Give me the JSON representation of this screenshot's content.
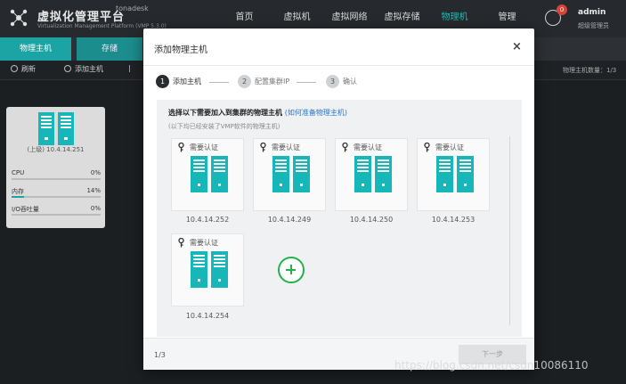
{
  "app": {
    "title": "虚拟化管理平台",
    "subtitle": "Virtualization Management Platform (VMP 5.3.0)",
    "user_line": "tonadesk"
  },
  "nav": [
    {
      "label": "首页"
    },
    {
      "label": "虚拟机"
    },
    {
      "label": "虚拟网络"
    },
    {
      "label": "虚拟存储"
    },
    {
      "label": "物理机"
    },
    {
      "label": "管理"
    }
  ],
  "notifications": {
    "count": "0"
  },
  "user": {
    "name": "admin",
    "role": "超级管理员"
  },
  "subtabs": [
    {
      "label": "物理主机"
    },
    {
      "label": "存储"
    }
  ],
  "toolbar": {
    "refresh_label": "刷新",
    "add_host_label": "添加主机",
    "more_label": "|",
    "host_count_label": "物理主机数量：1/3"
  },
  "host_card": {
    "name": "(上级) 10.4.14.251",
    "metrics": [
      {
        "label": "CPU",
        "value": "0%",
        "fill": 0.0
      },
      {
        "label": "内存",
        "value": "14%",
        "fill": 0.14
      },
      {
        "label": "I/O吞吐量",
        "value": "0%",
        "fill": 0.0
      }
    ]
  },
  "modal": {
    "title": "添加物理主机",
    "close_label": "×",
    "steps": [
      {
        "num": "1",
        "label": "添加主机"
      },
      {
        "num": "2",
        "label": "配置集群IP"
      },
      {
        "num": "3",
        "label": "确认"
      }
    ],
    "instruction": "选择以下需要加入到集群的物理主机",
    "instruction_link": "(如何准备物理主机)",
    "hint": "(以下均已经安装了VMP软件的物理主机)",
    "cards": [
      {
        "badge": "需要认证",
        "ip": "10.4.14.252"
      },
      {
        "badge": "需要认证",
        "ip": "10.4.14.249"
      },
      {
        "badge": "需要认证",
        "ip": "10.4.14.250"
      },
      {
        "badge": "需要认证",
        "ip": "10.4.14.253"
      },
      {
        "badge": "需要认证",
        "ip": "10.4.14.254"
      }
    ],
    "pager": "1/3",
    "next_label": "下一步"
  },
  "watermark": "https://blog.csdn.net/csdn10086110",
  "colors": {
    "accent": "#1fb8b8",
    "server": "#17b6b9",
    "add": "#22b24c"
  }
}
